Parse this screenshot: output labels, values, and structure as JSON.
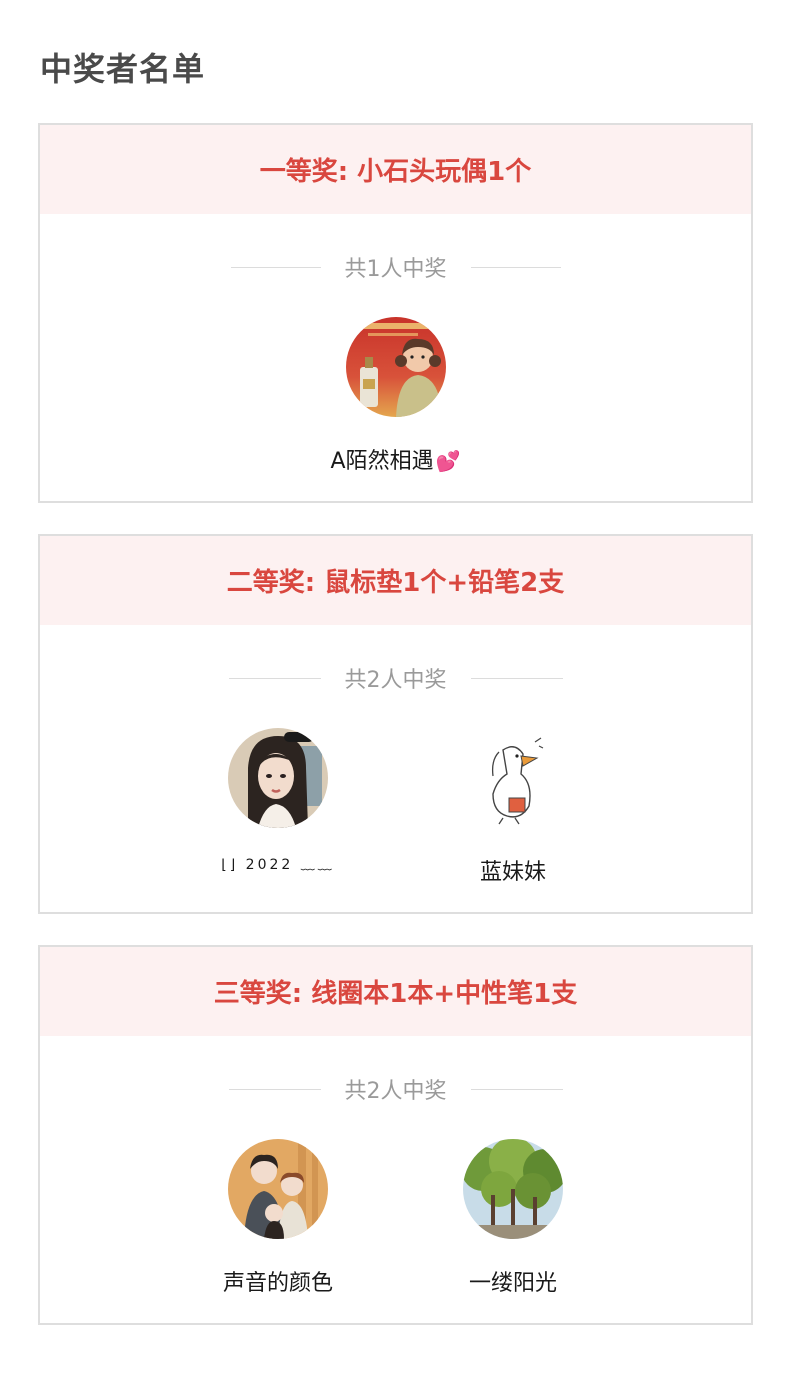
{
  "page": {
    "title": "中奖者名单"
  },
  "prizes": [
    {
      "title": "一等奖: 小石头玩偶1个",
      "count_text": "共1人中奖",
      "winners": [
        {
          "name": "A陌然相遇",
          "avatar": "perfume-girl-avatar",
          "emoji": "💕"
        }
      ]
    },
    {
      "title": "二等奖: 鼠标垫1个+铅笔2支",
      "count_text": "共2人中奖",
      "winners": [
        {
          "name": "⌊⌋ 2022 ﹏﹏",
          "avatar": "illustrated-woman-avatar"
        },
        {
          "name": "蓝妹妹",
          "avatar": "cartoon-duck-avatar"
        }
      ]
    },
    {
      "title": "三等奖: 线圈本1本+中性笔1支",
      "count_text": "共2人中奖",
      "winners": [
        {
          "name": "声音的颜色",
          "avatar": "cartoon-family-avatar"
        },
        {
          "name": "一缕阳光",
          "avatar": "trees-avatar"
        }
      ]
    }
  ],
  "colors": {
    "accent": "#d9473f",
    "header_bg": "#fdf1f1",
    "border": "#dedede",
    "muted": "#9a9a9a"
  }
}
